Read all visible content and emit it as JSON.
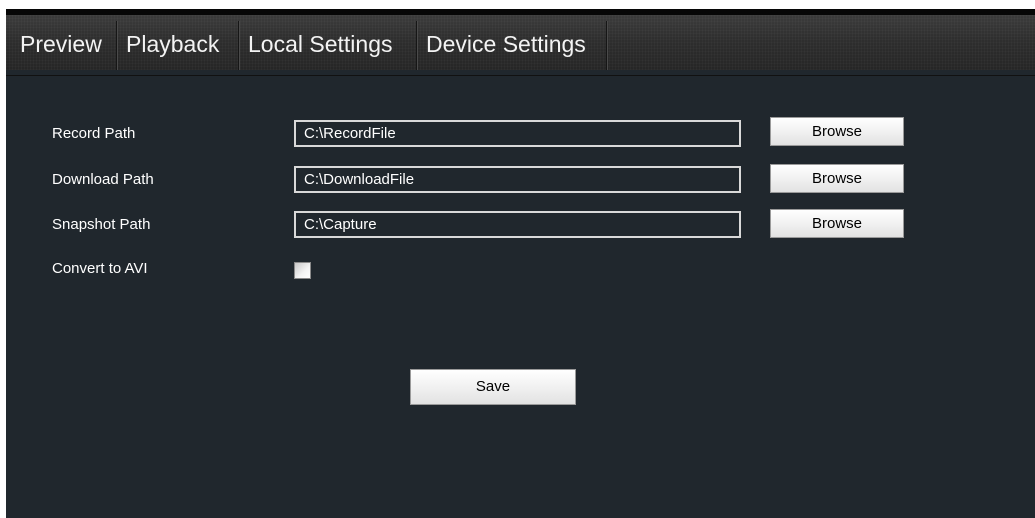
{
  "tabs": [
    {
      "label": "Preview"
    },
    {
      "label": "Playback"
    },
    {
      "label": "Local Settings"
    },
    {
      "label": "Device Settings"
    }
  ],
  "fields": [
    {
      "label": "Record Path",
      "value": "C:\\RecordFile",
      "button": "Browse"
    },
    {
      "label": "Download Path",
      "value": "C:\\DownloadFile",
      "button": "Browse"
    },
    {
      "label": "Snapshot Path",
      "value": "C:\\Capture",
      "button": "Browse"
    }
  ],
  "convert": {
    "label": "Convert to AVI",
    "checked": false
  },
  "save_label": "Save"
}
